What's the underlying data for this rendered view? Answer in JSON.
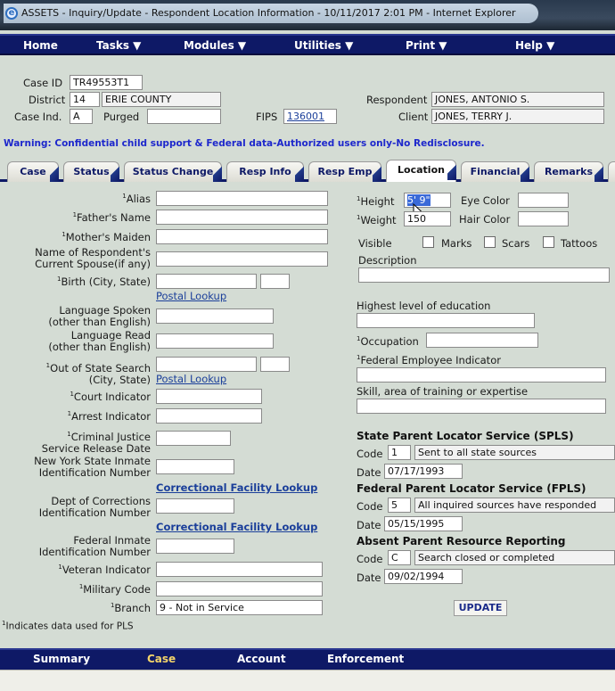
{
  "window": {
    "title": "ASSETS - Inquiry/Update - Respondent Location Information -  10/11/2017 2:01 PM - Internet Explorer",
    "browser_icon": "ie-icon"
  },
  "menu": [
    "Home",
    "Tasks ▼",
    "Modules ▼",
    "Utilities ▼",
    "Print ▼",
    "Help ▼"
  ],
  "header": {
    "case_id_label": "Case ID",
    "case_id": "TR49553T1",
    "district_label": "District",
    "district_code": "14",
    "district_name": "ERIE COUNTY",
    "case_ind_label": "Case Ind.",
    "case_ind": "A",
    "purged_label": "Purged",
    "purged": "",
    "fips_label": "FIPS",
    "fips": "136001",
    "respondent_label": "Respondent",
    "respondent": "JONES, ANTONIO S.",
    "client_label": "Client",
    "client": "JONES, TERRY J."
  },
  "warning": "Warning: Confidential child support & Federal data-Authorized users only-No Redisclosure.",
  "tabs": [
    "Case",
    "Status",
    "Status Change",
    "Resp Info",
    "Resp Emp",
    "Location",
    "Financial",
    "Remarks"
  ],
  "active_tab": "Location",
  "left": {
    "alias_label": "Alias",
    "fathers_name_label": "Father's Name",
    "mothers_maiden_label": "Mother's Maiden",
    "spouse_label_1": "Name of Respondent's",
    "spouse_label_2": "Current Spouse(if any)",
    "birth_label": "Birth (City, State)",
    "postal_lookup_1": "Postal Lookup",
    "lang_spoken_1": "Language Spoken",
    "lang_spoken_2": "(other than English)",
    "lang_read_1": "Language Read",
    "lang_read_2": "(other than English)",
    "oos_search_1": "Out of State Search",
    "oos_search_2": "(City, State)",
    "postal_lookup_2": "Postal Lookup",
    "court_label": "Court Indicator",
    "arrest_label": "Arrest Indicator",
    "cj_1": "Criminal Justice",
    "cj_2": "Service Release Date",
    "nys_1": "New York State Inmate",
    "nys_2": "Identification Number",
    "cf_lookup_1": "Correctional Facility Lookup",
    "doc_1": "Dept of Corrections",
    "doc_2": "Identification Number",
    "cf_lookup_2": "Correctional Facility Lookup",
    "fed_1": "Federal Inmate",
    "fed_2": "Identification Number",
    "veteran_label": "Veteran Indicator",
    "military_label": "Military Code",
    "branch_label": "Branch",
    "branch_value": "9 - Not in Service",
    "footnote": "Indicates data used for PLS"
  },
  "right": {
    "height_label": "Height",
    "height_value": "5' 9\"",
    "eye_color_label": "Eye Color",
    "weight_label": "Weight",
    "weight_value": "150",
    "hair_color_label": "Hair Color",
    "visible_label": "Visible",
    "marks_label": "Marks",
    "scars_label": "Scars",
    "tattoos_label": "Tattoos",
    "description_label": "Description",
    "education_label": "Highest level of education",
    "occupation_label": "Occupation",
    "fed_emp_label": "Federal Employee Indicator",
    "skill_label": "Skill, area of training or expertise",
    "spls_heading": "State Parent Locator Service (SPLS)",
    "spls_code": "1",
    "spls_desc": "Sent to all state sources",
    "spls_date": "07/17/1993",
    "fpls_heading": "Federal Parent Locator Service (FPLS)",
    "fpls_code": "5",
    "fpls_desc": "All inquired sources have responded",
    "fpls_date": "05/15/1995",
    "aprr_heading": "Absent Parent Resource Reporting",
    "aprr_code": "C",
    "aprr_desc": "Search closed or completed",
    "aprr_date": "09/02/1994",
    "code_label": "Code",
    "date_label": "Date",
    "update_label": "UPDATE"
  },
  "bottom_nav": [
    "Summary",
    "Case",
    "Account",
    "Enforcement"
  ],
  "bottom_active": "Case",
  "colors": {
    "nav": "#0e1966",
    "warning": "#1d27cc",
    "link": "#1b3f9a",
    "page_bg": "#d4dcd4",
    "active_bottom": "#f4d56a"
  }
}
